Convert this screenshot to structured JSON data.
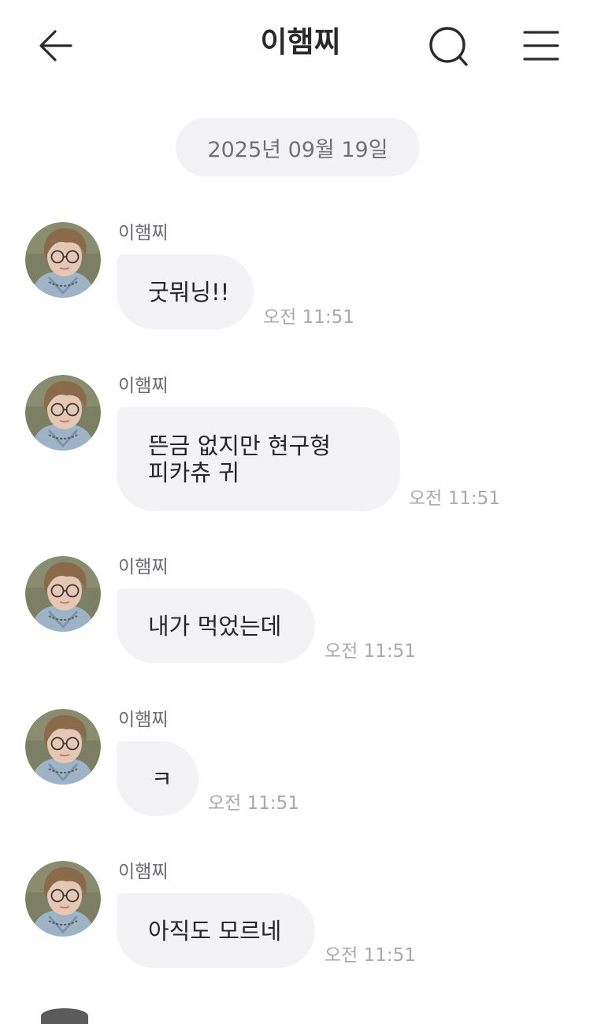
{
  "header": {
    "title": "이햄찌",
    "back_icon": "arrow-left-icon",
    "search_icon": "search-icon",
    "menu_icon": "menu-icon"
  },
  "date_divider": "2025년 09월 19일",
  "messages": [
    {
      "sender": "이햄찌",
      "lines": [
        "굿뭐닝!!"
      ],
      "time": "오전 11:51"
    },
    {
      "sender": "이햄찌",
      "lines": [
        "뜬금 없지만 현구형",
        "피카츄 귀"
      ],
      "time": "오전 11:51"
    },
    {
      "sender": "이햄찌",
      "lines": [
        "내가 먹었는데"
      ],
      "time": "오전 11:51"
    },
    {
      "sender": "이햄찌",
      "lines": [
        "ㅋ"
      ],
      "time": "오전 11:51"
    },
    {
      "sender": "이햄찌",
      "lines": [
        "아직도 모르네"
      ],
      "time": "오전 11:51"
    }
  ],
  "colors": {
    "bubble": "#f3f3f5",
    "time": "#a9a9ad",
    "sender": "#6b6b70"
  }
}
